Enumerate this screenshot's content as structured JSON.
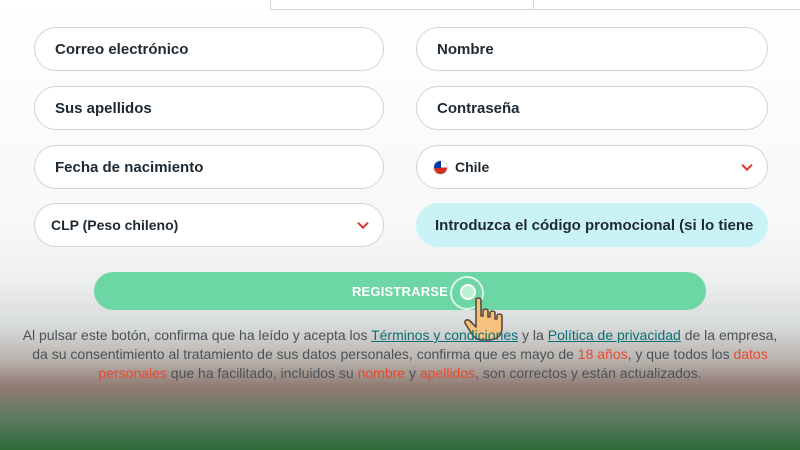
{
  "form": {
    "email_placeholder": "Correo electrónico",
    "name_placeholder": "Nombre",
    "surname_placeholder": "Sus apellidos",
    "password_placeholder": "Contraseña",
    "birthdate_placeholder": "Fecha de nacimiento",
    "country_value": "Chile",
    "currency_value": "CLP (Peso chileno)",
    "promo_placeholder": "Introduzca el código promocional (si lo tiene"
  },
  "register_button": {
    "label": "REGISTRARSE"
  },
  "legal": {
    "p1": "Al pulsar este botón, confirma que ha leído y acepta los ",
    "terms_link": "Términos y condiciones",
    "p2": " y la ",
    "privacy_link": "Política de privacidad",
    "p3": " de la empresa, da su consentimiento al tratamiento de sus datos personales, confirma que es mayo de ",
    "age": "18 años",
    "p4": ", y que todos los ",
    "personal_data": "datos personales",
    "p5": " que ha facilitado, incluidos su ",
    "name_word": "nombre",
    "p6": " y ",
    "surname_word": "apellidos",
    "p7": ", son correctos y están actualizados."
  },
  "colors": {
    "button_bg": "#6dd6a5",
    "promo_bg": "#c9f3f6",
    "accent_red": "#e8492f",
    "link": "#0a6f7a"
  },
  "icons": {
    "flag": "chile-flag-icon",
    "chevron": "chevron-down-icon",
    "cursor": "pointer-hand-icon"
  }
}
